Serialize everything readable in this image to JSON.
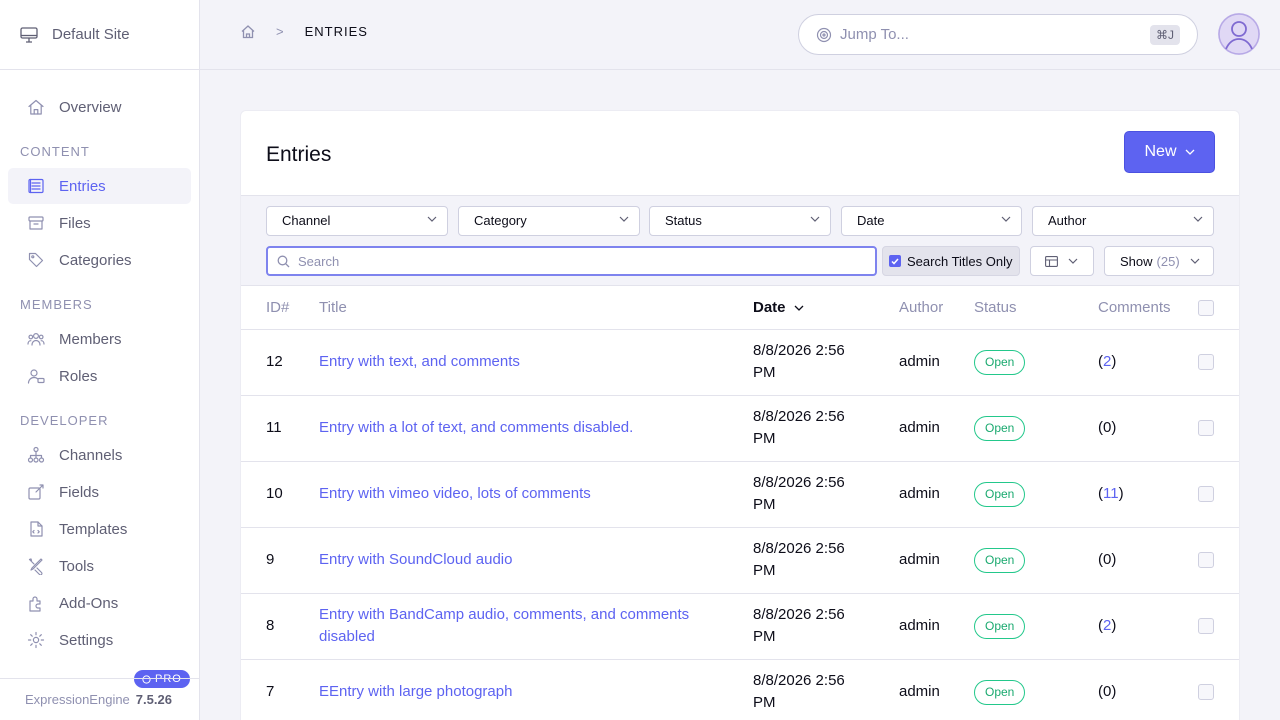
{
  "sidebar": {
    "site_name": "Default Site",
    "items_top": [
      {
        "label": "Overview",
        "icon": "home-icon"
      }
    ],
    "sections": [
      {
        "title": "CONTENT",
        "items": [
          {
            "label": "Entries",
            "icon": "entries-icon",
            "active": true
          },
          {
            "label": "Files",
            "icon": "files-icon"
          },
          {
            "label": "Categories",
            "icon": "tag-icon"
          }
        ]
      },
      {
        "title": "MEMBERS",
        "items": [
          {
            "label": "Members",
            "icon": "members-icon"
          },
          {
            "label": "Roles",
            "icon": "roles-icon"
          }
        ]
      },
      {
        "title": "DEVELOPER",
        "items": [
          {
            "label": "Channels",
            "icon": "channels-icon"
          },
          {
            "label": "Fields",
            "icon": "fields-icon"
          },
          {
            "label": "Templates",
            "icon": "templates-icon"
          },
          {
            "label": "Tools",
            "icon": "tools-icon"
          },
          {
            "label": "Add-Ons",
            "icon": "addons-icon"
          },
          {
            "label": "Settings",
            "icon": "gear-icon"
          }
        ]
      }
    ],
    "footer": {
      "product": "ExpressionEngine",
      "version": "7.5.26",
      "badge": "PRO"
    }
  },
  "header": {
    "breadcrumb_current": "ENTRIES",
    "breadcrumb_separator": ">",
    "jump_placeholder": "Jump To...",
    "jump_shortcut": "⌘J"
  },
  "panel": {
    "title": "Entries",
    "new_button": "New"
  },
  "filters": {
    "selects": [
      "Channel",
      "Category",
      "Status",
      "Date",
      "Author"
    ],
    "search_placeholder": "Search",
    "search_titles_only": "Search Titles Only",
    "show_label": "Show",
    "show_count": "(25)"
  },
  "table": {
    "columns": {
      "id": "ID#",
      "title": "Title",
      "date": "Date",
      "author": "Author",
      "status": "Status",
      "comments": "Comments"
    },
    "sorted_column": "Date",
    "rows": [
      {
        "id": "12",
        "title": "Entry with text, and comments",
        "date_line1": "8/8/2026 2:56",
        "date_line2": "PM",
        "author": "admin",
        "status": "Open",
        "comments": "2",
        "comments_linked": true
      },
      {
        "id": "11",
        "title": "Entry with a lot of text, and comments disabled.",
        "date_line1": "8/8/2026 2:56",
        "date_line2": "PM",
        "author": "admin",
        "status": "Open",
        "comments": "0",
        "comments_linked": false
      },
      {
        "id": "10",
        "title": "Entry with vimeo video, lots of comments",
        "date_line1": "8/8/2026 2:56",
        "date_line2": "PM",
        "author": "admin",
        "status": "Open",
        "comments": "11",
        "comments_linked": true
      },
      {
        "id": "9",
        "title": "Entry with SoundCloud audio",
        "date_line1": "8/8/2026 2:56",
        "date_line2": "PM",
        "author": "admin",
        "status": "Open",
        "comments": "0",
        "comments_linked": false
      },
      {
        "id": "8",
        "title": "Entry with BandCamp audio, comments, and comments disabled",
        "date_line1": "8/8/2026 2:56",
        "date_line2": "PM",
        "author": "admin",
        "status": "Open",
        "comments": "2",
        "comments_linked": true
      },
      {
        "id": "7",
        "title": "EEntry with large photograph",
        "date_line1": "8/8/2026 2:56",
        "date_line2": "PM",
        "author": "admin",
        "status": "Open",
        "comments": "0",
        "comments_linked": false
      }
    ]
  },
  "colors": {
    "accent": "#5d63f1",
    "status_open": "#1aa96f",
    "muted": "#8f90b0"
  }
}
